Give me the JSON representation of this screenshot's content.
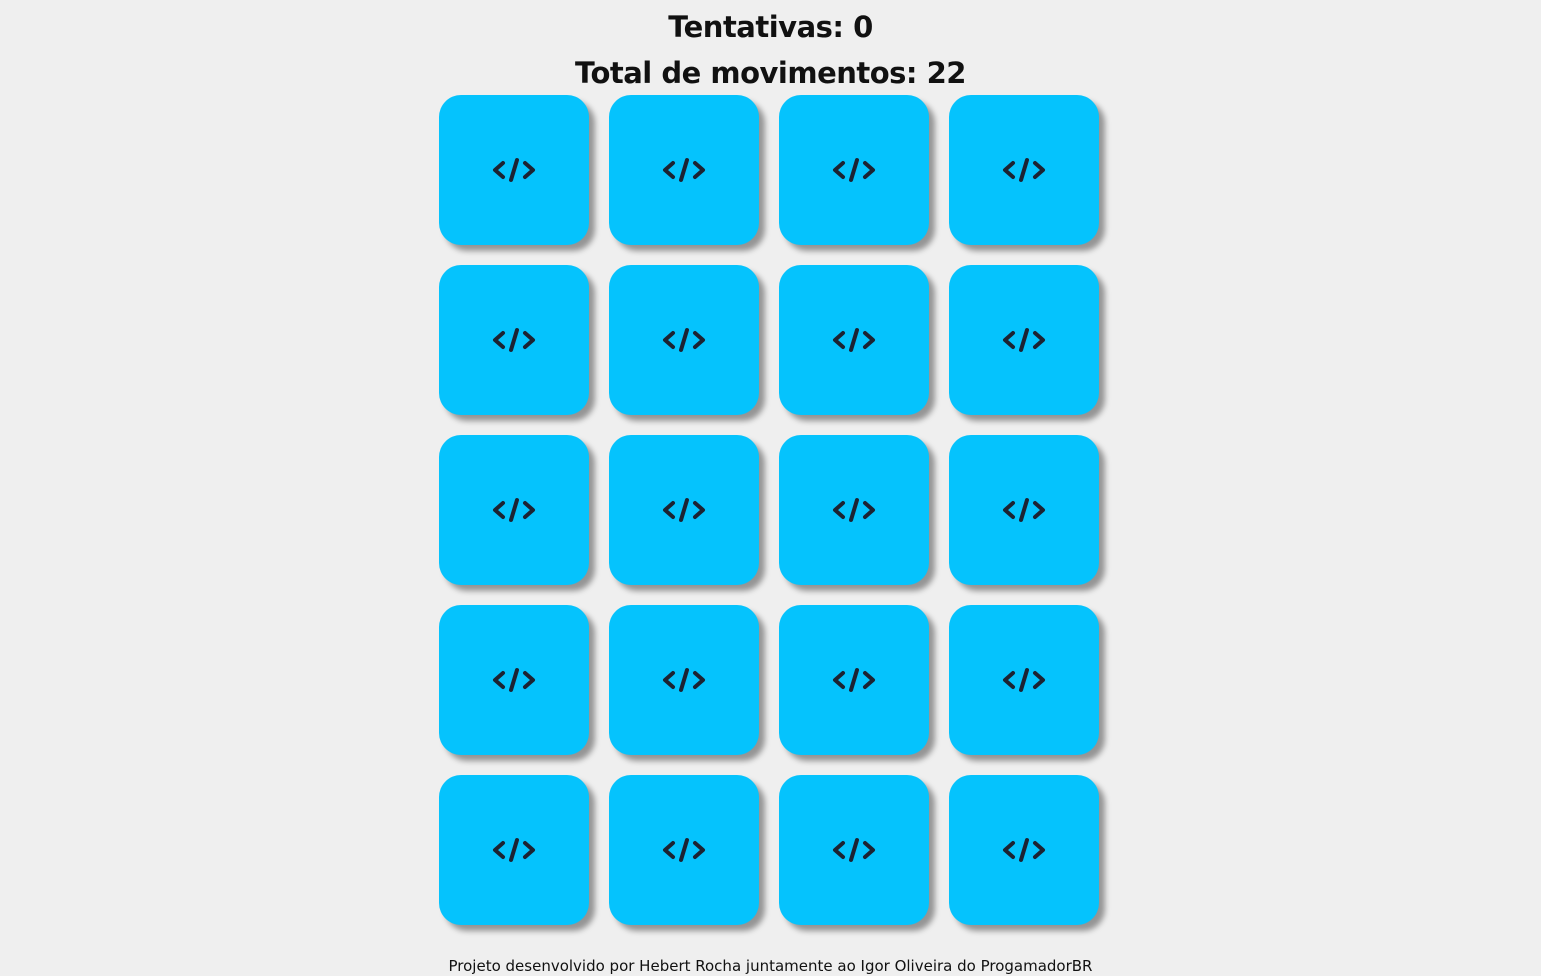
{
  "header": {
    "attempts_text": "Tentativas: 0",
    "moves_text": "Total de movimentos: 22"
  },
  "board": {
    "rows": 5,
    "columns": 4,
    "card_color": "#05c3fd",
    "card_face_icon": "code-icon",
    "cards": [
      {
        "icon": "code-icon",
        "face": "down"
      },
      {
        "icon": "code-icon",
        "face": "down"
      },
      {
        "icon": "code-icon",
        "face": "down"
      },
      {
        "icon": "code-icon",
        "face": "down"
      },
      {
        "icon": "code-icon",
        "face": "down"
      },
      {
        "icon": "code-icon",
        "face": "down"
      },
      {
        "icon": "code-icon",
        "face": "down"
      },
      {
        "icon": "code-icon",
        "face": "down"
      },
      {
        "icon": "code-icon",
        "face": "down"
      },
      {
        "icon": "code-icon",
        "face": "down"
      },
      {
        "icon": "code-icon",
        "face": "down"
      },
      {
        "icon": "code-icon",
        "face": "down"
      },
      {
        "icon": "code-icon",
        "face": "down"
      },
      {
        "icon": "code-icon",
        "face": "down"
      },
      {
        "icon": "code-icon",
        "face": "down"
      },
      {
        "icon": "code-icon",
        "face": "down"
      },
      {
        "icon": "code-icon",
        "face": "down"
      },
      {
        "icon": "code-icon",
        "face": "down"
      },
      {
        "icon": "code-icon",
        "face": "down"
      },
      {
        "icon": "code-icon",
        "face": "down"
      }
    ]
  },
  "footer": {
    "credit_text": "Projeto desenvolvido por Hebert Rocha juntamente ao Igor Oliveira do ProgamadorBR"
  }
}
